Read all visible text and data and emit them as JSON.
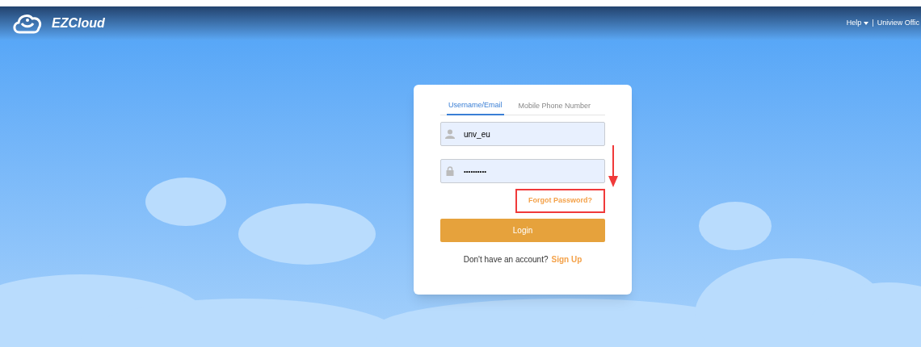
{
  "header": {
    "logo_text": "EZCloud",
    "help": "Help",
    "separator": "|",
    "official": "Uniview Offic"
  },
  "login": {
    "tabs": [
      {
        "label": "Username/Email",
        "selected": true
      },
      {
        "label": "Mobile Phone Number",
        "selected": false
      }
    ],
    "username": {
      "value": "unv_eu"
    },
    "password": {
      "value": "••••••••••"
    },
    "forgot": {
      "label": "Forgot Password?",
      "highlighted": true
    },
    "login_button": "Login",
    "signup_prompt": "Don't have an account?",
    "signup_link": "Sign Up"
  }
}
